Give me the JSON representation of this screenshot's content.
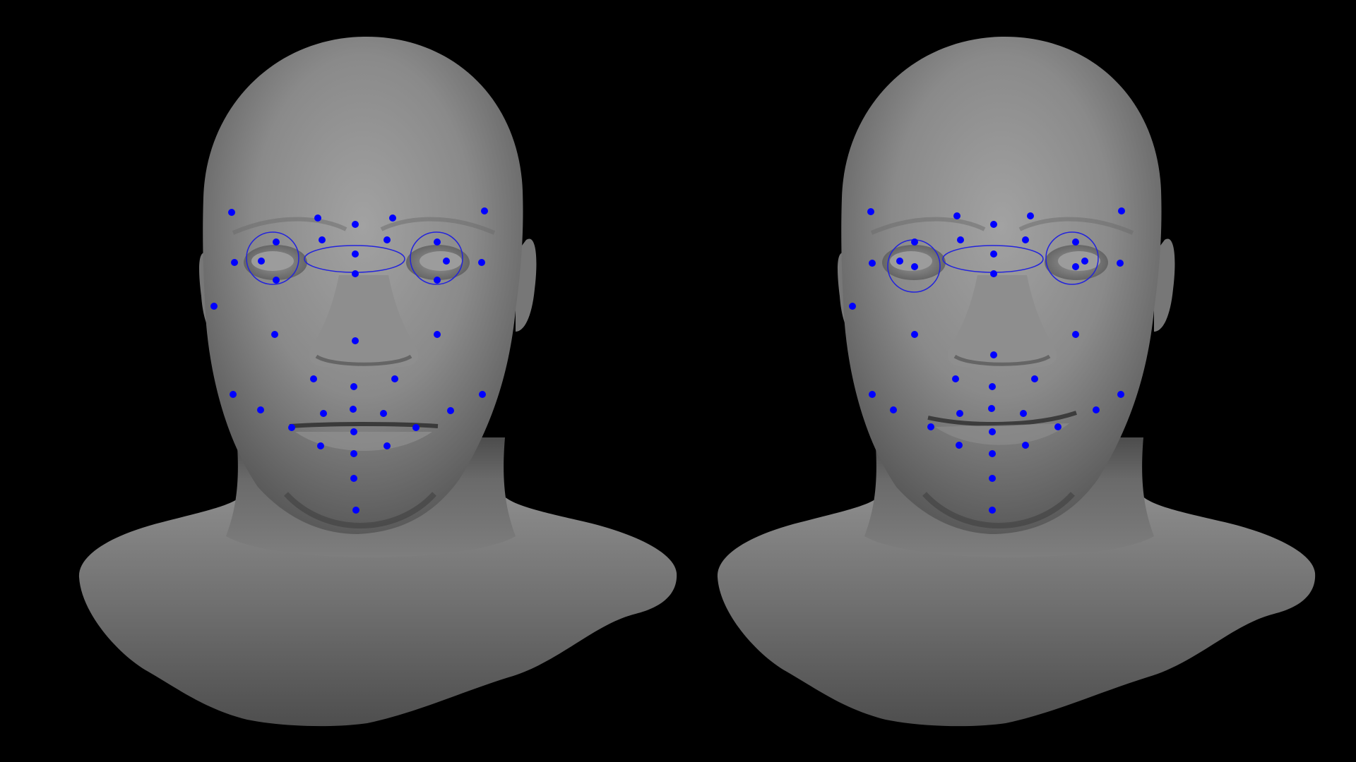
{
  "viewport": {
    "background": "#000000",
    "views": [
      {
        "id": "neutral",
        "expression": "neutral"
      },
      {
        "id": "smile",
        "expression": "smile"
      }
    ]
  },
  "style": {
    "head_color_light": "#a3a3a3",
    "head_color_mid": "#808080",
    "head_color_dark": "#4a4a4a",
    "landmark_color": "#0000ff",
    "guide_color": "#2222dd"
  },
  "landmarks": {
    "count_per_view": 39,
    "guides_per_view": 3
  }
}
